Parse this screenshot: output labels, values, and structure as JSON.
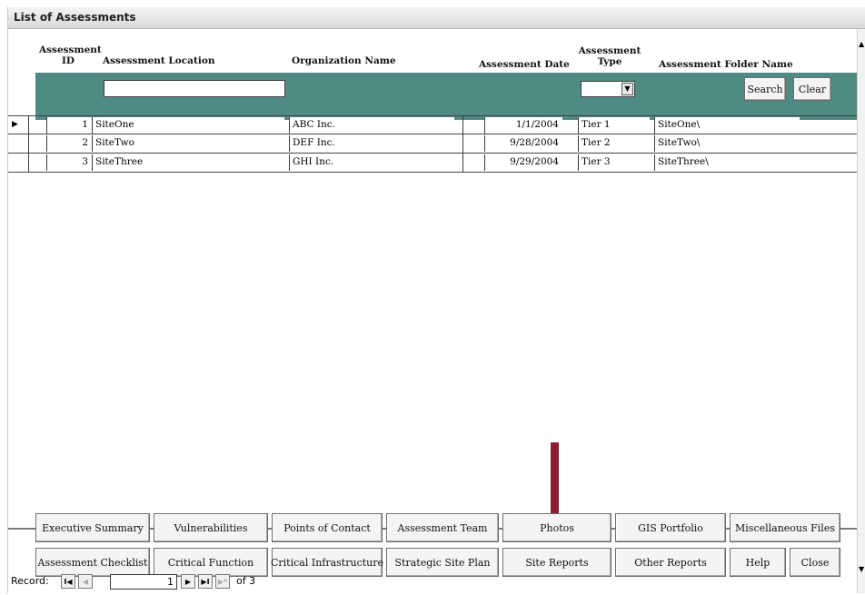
{
  "window": {
    "title": "List of Assessments"
  },
  "columns": {
    "assessment_id": [
      "Assessment",
      "ID"
    ],
    "location": "Assessment Location",
    "organization": "Organization Name",
    "date": "Assessment Date",
    "type": [
      "Assessment",
      "Type"
    ],
    "folder": "Assessment Folder Name"
  },
  "filter": {
    "location_value": "",
    "type_value": "",
    "search_label": "Search",
    "clear_label": "Clear"
  },
  "rows": [
    {
      "id": "1",
      "location": "SiteOne",
      "organization": "ABC Inc.",
      "date": "1/1/2004",
      "type": "Tier 1",
      "folder": "SiteOne\\"
    },
    {
      "id": "2",
      "location": "SiteTwo",
      "organization": "DEF Inc.",
      "date": "9/28/2004",
      "type": "Tier 2",
      "folder": "SiteTwo\\"
    },
    {
      "id": "3",
      "location": "SiteThree",
      "organization": "GHI Inc.",
      "date": "9/29/2004",
      "type": "Tier 3",
      "folder": "SiteThree\\"
    }
  ],
  "buttons_row1": [
    "Executive Summary",
    "Vulnerabilities",
    "Points of Contact",
    "Assessment Team",
    "Photos",
    "GIS Portfolio",
    "Miscellaneous Files"
  ],
  "buttons_row2": [
    "Assessment Checklist",
    "Critical Function",
    "Critical Infrastructure",
    "Strategic Site Plan",
    "Site Reports",
    "Other Reports",
    "Help",
    "Close"
  ],
  "navigator": {
    "record_label": "Record:",
    "current": "1",
    "of_label": "of 3"
  },
  "colors": {
    "filter_bar": "#4f8a84",
    "arrow": "#8c1c33"
  }
}
